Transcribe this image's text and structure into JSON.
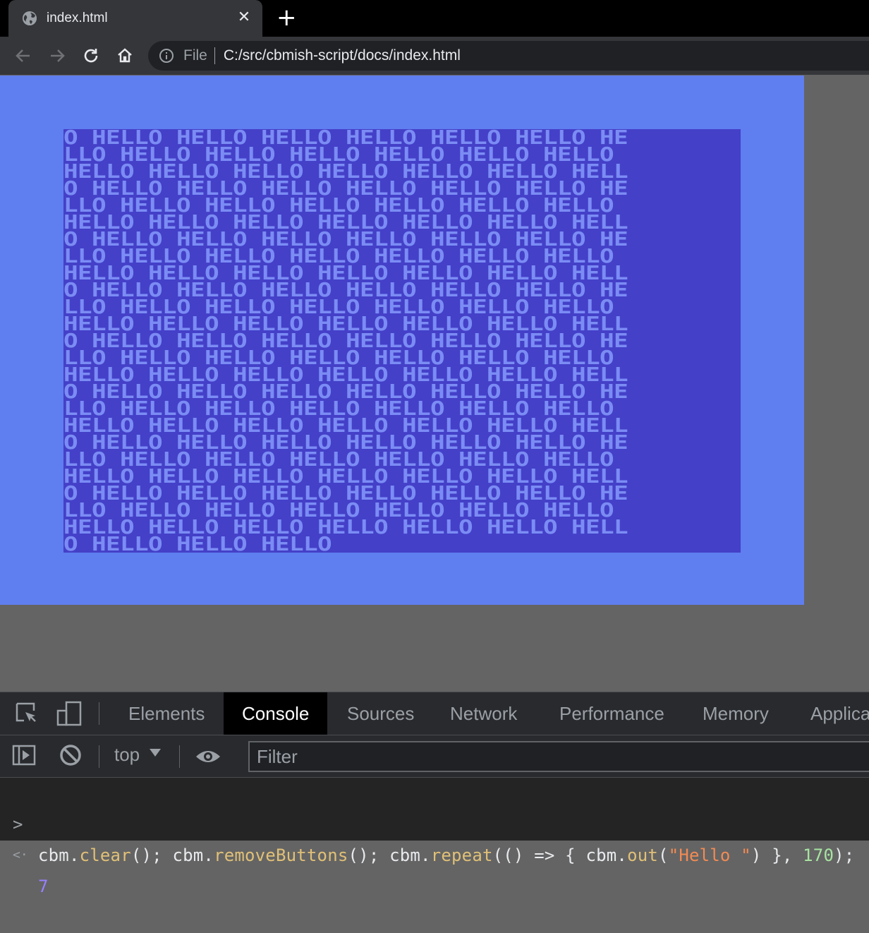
{
  "browser": {
    "tab_title": "index.html",
    "tab_close": "✕",
    "new_tab": "+",
    "omnibox": {
      "scheme": "File",
      "url": "C:/src/cbmish-script/docs/index.html"
    }
  },
  "c64": {
    "border_color": "#5f7eef",
    "screen_color": "#4440c8",
    "text_color": "#7b8cf4",
    "lines": [
      "O HELLO HELLO HELLO HELLO HELLO HELLO HE",
      "LLO HELLO HELLO HELLO HELLO HELLO HELLO ",
      "HELLO HELLO HELLO HELLO HELLO HELLO HELL",
      "O HELLO HELLO HELLO HELLO HELLO HELLO HE",
      "LLO HELLO HELLO HELLO HELLO HELLO HELLO ",
      "HELLO HELLO HELLO HELLO HELLO HELLO HELL",
      "O HELLO HELLO HELLO HELLO HELLO HELLO HE",
      "LLO HELLO HELLO HELLO HELLO HELLO HELLO ",
      "HELLO HELLO HELLO HELLO HELLO HELLO HELL",
      "O HELLO HELLO HELLO HELLO HELLO HELLO HE",
      "LLO HELLO HELLO HELLO HELLO HELLO HELLO ",
      "HELLO HELLO HELLO HELLO HELLO HELLO HELL",
      "O HELLO HELLO HELLO HELLO HELLO HELLO HE",
      "LLO HELLO HELLO HELLO HELLO HELLO HELLO ",
      "HELLO HELLO HELLO HELLO HELLO HELLO HELL",
      "O HELLO HELLO HELLO HELLO HELLO HELLO HE",
      "LLO HELLO HELLO HELLO HELLO HELLO HELLO ",
      "HELLO HELLO HELLO HELLO HELLO HELLO HELL",
      "O HELLO HELLO HELLO HELLO HELLO HELLO HE",
      "LLO HELLO HELLO HELLO HELLO HELLO HELLO ",
      "HELLO HELLO HELLO HELLO HELLO HELLO HELL",
      "O HELLO HELLO HELLO HELLO HELLO HELLO HE",
      "LLO HELLO HELLO HELLO HELLO HELLO HELLO ",
      "HELLO HELLO HELLO HELLO HELLO HELLO HELL",
      "O HELLO HELLO HELLO"
    ]
  },
  "devtools": {
    "tabs": [
      "Elements",
      "Console",
      "Sources",
      "Network",
      "Performance",
      "Memory",
      "Applica"
    ],
    "active_tab": "Console",
    "context": "top",
    "filter_placeholder": "Filter",
    "console": {
      "input_prompt": ">",
      "input_tokens": [
        {
          "t": "cbm.",
          "c": ""
        },
        {
          "t": "clear",
          "c": "tok-fn"
        },
        {
          "t": "(); cbm.",
          "c": ""
        },
        {
          "t": "removeButtons",
          "c": "tok-fn"
        },
        {
          "t": "(); cbm.",
          "c": ""
        },
        {
          "t": "repeat",
          "c": "tok-fn"
        },
        {
          "t": "(() => { cbm.",
          "c": ""
        },
        {
          "t": "out",
          "c": "tok-fn"
        },
        {
          "t": "(",
          "c": ""
        },
        {
          "t": "\"Hello \"",
          "c": "tok-str"
        },
        {
          "t": ") }, ",
          "c": ""
        },
        {
          "t": "170",
          "c": "tok-num"
        },
        {
          "t": ");",
          "c": ""
        }
      ],
      "output_prompt": "<·",
      "output_value": "7"
    }
  }
}
